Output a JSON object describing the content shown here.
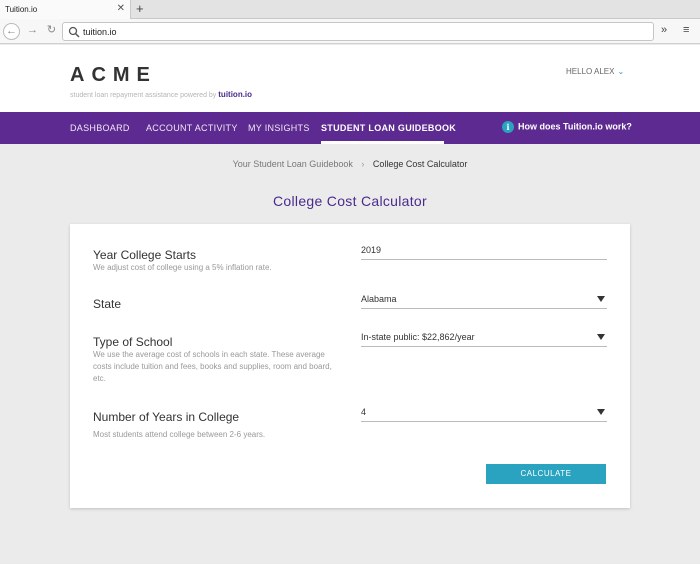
{
  "browser": {
    "tab_title": "Tuition.io",
    "tab_close": "✕",
    "new_tab": "+",
    "url": "tuition.io",
    "more": "»",
    "menu": "≡"
  },
  "header": {
    "logo": "ACME",
    "tagline": "student loan repayment assistance powered by",
    "tagline_brand": "tuition.io",
    "user_greeting": "HELLO ALEX"
  },
  "nav": {
    "items": [
      {
        "label": "DASHBOARD"
      },
      {
        "label": "ACCOUNT ACTIVITY"
      },
      {
        "label": "MY INSIGHTS"
      },
      {
        "label": "STUDENT LOAN GUIDEBOOK"
      }
    ],
    "active_index": 3,
    "help_link": "How does Tuition.io work?"
  },
  "breadcrumb": {
    "parent": "Your Student Loan Guidebook",
    "separator": "›",
    "current": "College Cost Calculator"
  },
  "page_title": "College Cost Calculator",
  "form": {
    "fields": [
      {
        "label": "Year College Starts",
        "help": "We adjust cost of college using a 5% inflation rate.",
        "value": "2019",
        "type": "input"
      },
      {
        "label": "State",
        "help": "",
        "value": "Alabama",
        "type": "select"
      },
      {
        "label": "Type of School",
        "help": "We use the average cost of schools in each state. These average costs include tuition and fees, books and supplies, room and board, etc.",
        "value": "In-state public: $22,862/year",
        "type": "select"
      },
      {
        "label": "Number of Years in College",
        "help": "Most students attend college between 2-6 years.",
        "value": "4",
        "type": "select"
      }
    ],
    "submit_label": "CALCULATE"
  },
  "colors": {
    "nav_purple": "#5d2a91",
    "title_purple": "#4a2a8c",
    "accent_teal": "#2aa3c1"
  }
}
